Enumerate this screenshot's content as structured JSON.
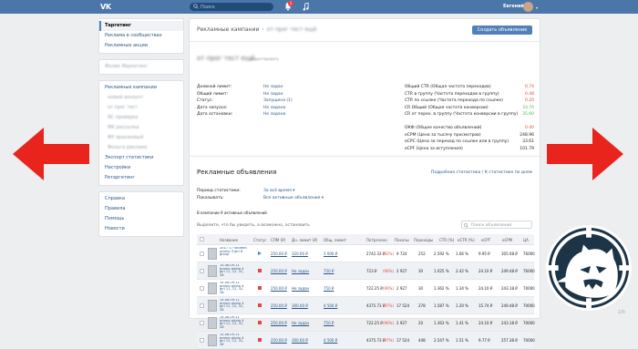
{
  "topbar": {
    "logo": "VK",
    "search_placeholder": "Поиск",
    "notifications": "1",
    "user_name": "Евгений"
  },
  "sidebar": {
    "primary": [
      {
        "label": "Таргетинг",
        "active": true
      },
      {
        "label": "Реклама в сообществах"
      },
      {
        "label": "Рекламные акции"
      }
    ],
    "account_blur": "Фолио Маркетинг",
    "campaigns_header": "Рекламные кампании",
    "campaigns_blur": [
      "новый аккаунт",
      "от прог тест",
      "ЯС проверка",
      "МК рассылка",
      "ФУ оранжевый",
      "Фольга реклама"
    ],
    "more": [
      "Экспорт статистики",
      "Настройки",
      "Ретаргетинг"
    ],
    "links": [
      "Справка",
      "Правила",
      "Помощь",
      "Новости"
    ]
  },
  "header": {
    "crumb_root": "Рекламные кампании",
    "crumb_blur": "от прог тест ещё",
    "create_button": "Создать объявление"
  },
  "campaign": {
    "name_blur": "от прог тест ещё",
    "id_blur": "редактировать"
  },
  "params": [
    {
      "k": "Дневной лимит:",
      "v": "Не задан"
    },
    {
      "k": "Общий лимит:",
      "v": "Не задан"
    },
    {
      "k": "Статус:",
      "v": "Запущена (1)"
    },
    {
      "k": "Дата запуска:",
      "v": "Не задана"
    },
    {
      "k": "Дата остановки:",
      "v": "Не задана"
    }
  ],
  "metrics": [
    {
      "k": "Общий CTR (Общая частота переходов)",
      "v": "0.74",
      "c": "red"
    },
    {
      "k": "CTR в группу (Частота переходов в группу)",
      "v": "0.48",
      "c": "red"
    },
    {
      "k": "CTR по ссылке (Частота перехода по ссылке)",
      "v": "0.20",
      "c": "red"
    },
    {
      "k": "CR Общий (Общая частота конверсии)",
      "v": "33.70",
      "c": "green"
    },
    {
      "k": "CR от перех. в группу (Частота конверсии в группу)",
      "v": "35.60",
      "c": "green"
    },
    {
      "k": "",
      "v": "",
      "c": ""
    },
    {
      "k": "ОКФ (Общее качество объявлений)",
      "v": "0.40",
      "c": "red"
    },
    {
      "k": "eCPM (Цена за тысячу просмотров)",
      "v": "248.96",
      "c": ""
    },
    {
      "k": "eCPC (Цена за переход по ссылке или в группу)",
      "v": "33.61",
      "c": ""
    },
    {
      "k": "eCPF (Цена за вступления)",
      "v": "101.79",
      "c": ""
    }
  ],
  "ads": {
    "title": "Рекламные объявления",
    "stats_link": "Подробная статистика",
    "stats_sep": "/",
    "stats_link2": "К статистике по дням",
    "period_label": "Период статистики:",
    "period_value": "За всё время ▾",
    "show_label": "Показывать:",
    "show_value": "Все активные объявления ▾",
    "active_count": "В кампании 9 активных объявлений",
    "selection_hint": "Выделите, что бы увидеть, а возможно, остановить",
    "search_placeholder": "Поиск объявлений"
  },
  "table": {
    "headers": [
      "Название",
      "Статус",
      "СПМ (₽)",
      "Дн. лимит (₽)",
      "Общ. лимит",
      "Потрачено",
      "Показы",
      "Переходы",
      "CTR (%)",
      "eCTR (%)",
      "eCPT",
      "eCPM",
      "ЦА"
    ],
    "rows": [
      {
        "name": "2017 17 student promo 3 girl 8 group",
        "status": "play",
        "cpm": "250.00 ₽",
        "day": "320.00 ₽",
        "total": "3 000 ₽",
        "spent": "2742.33 ₽",
        "spent_pct": "(92%)",
        "shows": "9 724",
        "clicks": "252",
        "ctr": "2.592 %",
        "ectr": "1.66 %",
        "ecpt": "9.95 ₽",
        "ecpm": "305.08 ₽",
        "ca": "76000"
      },
      {
        "name": "14.08.09.11 promo photo 4 girl 11, 12, 31, 28",
        "status": "stop",
        "cpm": "250.00 ₽",
        "day": "Не задан",
        "total": "750 ₽",
        "spent": "723 ₽",
        "spent_pct": "(96%)",
        "shows": "2 927",
        "clicks": "30",
        "ctr": "1.025 %",
        "ectr": "2.42 %",
        "ecpt": "24.10 ₽",
        "ecpm": "249.48 ₽",
        "ca": "76000"
      },
      {
        "name": "14.08.09.11 promo photo 4 girl 11, 12, 31, 28",
        "status": "stop",
        "cpm": "250.00 ₽",
        "day": "Не задан",
        "total": "750 ₽",
        "spent": "722.25 ₽",
        "spent_pct": "(96%)",
        "shows": "2 927",
        "clicks": "30",
        "ctr": "1.362 %",
        "ectr": "1.34 %",
        "ecpt": "24.10 ₽",
        "ecpm": "243.18 ₽",
        "ca": "70000"
      },
      {
        "name": "14.08.09.11 promo photo 4 girl 11, 12, 31, 28",
        "status": "stop",
        "cpm": "250.00 ₽",
        "day": "300.00 ₽",
        "total": "4 500 ₽",
        "spent": "4375.73 ₽",
        "spent_pct": "(97%)",
        "shows": "17 524",
        "clicks": "278",
        "ctr": "1.587 %",
        "ectr": "1.20 %",
        "ecpt": "15.74 ₽",
        "ecpm": "249.48 ₽",
        "ca": "70000"
      },
      {
        "name": "14.08.09.11 promo photo 4 girl 11, 12, 31, 28",
        "status": "stop",
        "cpm": "250.00 ₽",
        "day": "Не задан",
        "total": "750 ₽",
        "spent": "722.25 ₽",
        "spent_pct": "(96%)",
        "shows": "2 927",
        "clicks": "20",
        "ctr": "1.363 %",
        "ectr": "1.41 %",
        "ecpt": "24.10 ₽",
        "ecpm": "243.18 ₽",
        "ca": "70000"
      },
      {
        "name": "14.08.09.11 promo photo 4 girl 11, 12, 31, 28",
        "status": "stop",
        "cpm": "250.00 ₽",
        "day": "300.00 ₽",
        "total": "4 500 ₽",
        "spent": "4375.73 ₽",
        "spent_pct": "(97%)",
        "shows": "17 524",
        "clicks": "448",
        "ctr": "2.547 %",
        "ectr": "1.51 %",
        "ecpt": "9.77 ₽",
        "ecpm": "257.38 ₽",
        "ca": "70000"
      }
    ]
  },
  "page_count": "170"
}
